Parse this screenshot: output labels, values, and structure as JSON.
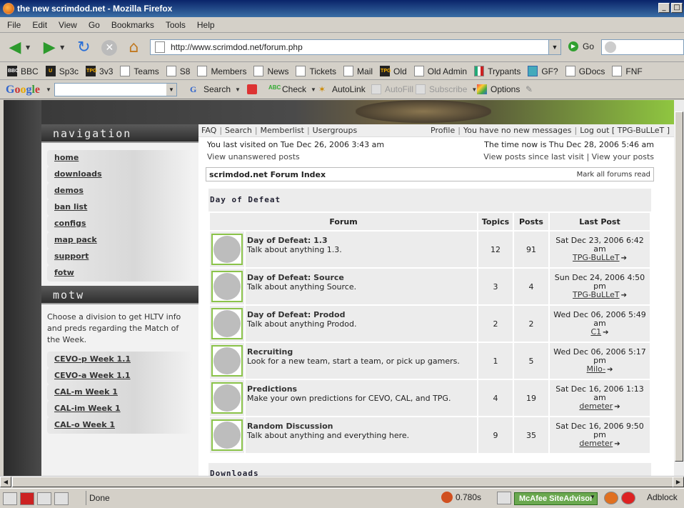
{
  "window": {
    "title": "the new scrimdod.net - Mozilla Firefox"
  },
  "menu": [
    "File",
    "Edit",
    "View",
    "Go",
    "Bookmarks",
    "Tools",
    "Help"
  ],
  "nav": {
    "url": "http://www.scrimdod.net/forum.php",
    "go_label": "Go"
  },
  "bookmarks": [
    {
      "label": "BBC",
      "icon": "bbc"
    },
    {
      "label": "Sp3c",
      "icon": "sp3c"
    },
    {
      "label": "3v3",
      "icon": "tpg"
    },
    {
      "label": "Teams",
      "icon": "page"
    },
    {
      "label": "S8",
      "icon": "page"
    },
    {
      "label": "Members",
      "icon": "page"
    },
    {
      "label": "News",
      "icon": "page"
    },
    {
      "label": "Tickets",
      "icon": "page"
    },
    {
      "label": "Mail",
      "icon": "page"
    },
    {
      "label": "Old",
      "icon": "tpg"
    },
    {
      "label": "Old Admin",
      "icon": "page"
    },
    {
      "label": "Trypants",
      "icon": "flag"
    },
    {
      "label": "GF?",
      "icon": "blue"
    },
    {
      "label": "GDocs",
      "icon": "page"
    },
    {
      "label": "FNF",
      "icon": "page"
    }
  ],
  "googlebar": {
    "logo": "Google",
    "search_label": "Search",
    "check_label": "Check",
    "autolink_label": "AutoLink",
    "autofill_label": "AutoFill",
    "subscribe_label": "Subscribe",
    "options_label": "Options"
  },
  "sidebar": {
    "nav_heading": "navigation",
    "nav_items": [
      "home",
      "downloads",
      "demos",
      "ban list",
      "configs",
      "map pack",
      "support",
      "fotw"
    ],
    "motw_heading": "motw",
    "motw_text": "Choose a division to get HLTV info and preds regarding the Match of the Week.",
    "motw_items": [
      "CEVO-p Week 1.1",
      "CEVO-a Week 1.1",
      "CAL-m Week 1",
      "CAL-im Week 1",
      "CAL-o Week 1"
    ]
  },
  "topnav": {
    "left": [
      "FAQ",
      "Search",
      "Memberlist",
      "Usergroups"
    ],
    "profile": "Profile",
    "messages": "You have no new messages",
    "logout": "Log out [ TPG-BuLLeT ]"
  },
  "info": {
    "last_visit": "You last visited on Tue Dec 26, 2006 3:43 am",
    "time_now": "The time now is Thu Dec 28, 2006 5:46 am",
    "unanswered": "View unanswered posts",
    "since_last": "View posts since last visit",
    "your_posts": "View your posts"
  },
  "crumb": {
    "index": "scrimdod.net Forum Index",
    "mark_read": "Mark all forums read"
  },
  "category": {
    "title": "Day of Defeat",
    "headers": {
      "forum": "Forum",
      "topics": "Topics",
      "posts": "Posts",
      "last_post": "Last Post"
    },
    "forums": [
      {
        "name": "Day of Defeat: 1.3",
        "desc": "Talk about anything 1.3.",
        "topics": "12",
        "posts": "91",
        "last_date": "Sat Dec 23, 2006 6:42 am",
        "last_user": "TPG-BuLLeT"
      },
      {
        "name": "Day of Defeat: Source",
        "desc": "Talk about anything Source.",
        "topics": "3",
        "posts": "4",
        "last_date": "Sun Dec 24, 2006 4:50 pm",
        "last_user": "TPG-BuLLeT"
      },
      {
        "name": "Day of Defeat: Prodod",
        "desc": "Talk about anything Prodod.",
        "topics": "2",
        "posts": "2",
        "last_date": "Wed Dec 06, 2006 5:49 am",
        "last_user": "C1"
      },
      {
        "name": "Recruiting",
        "desc": "Look for a new team, start a team, or pick up gamers.",
        "topics": "1",
        "posts": "5",
        "last_date": "Wed Dec 06, 2006 5:17 pm",
        "last_user": "Milo-"
      },
      {
        "name": "Predictions",
        "desc": "Make your own predictions for CEVO, CAL, and TPG.",
        "topics": "4",
        "posts": "19",
        "last_date": "Sat Dec 16, 2006 1:13 am",
        "last_user": "demeter"
      },
      {
        "name": "Random Discussion",
        "desc": "Talk about anything and everything here.",
        "topics": "9",
        "posts": "35",
        "last_date": "Sat Dec 16, 2006 9:50 pm",
        "last_user": "demeter"
      }
    ]
  },
  "next_category": "Downloads",
  "status": {
    "text": "Done",
    "time": "0.780s",
    "mcafee": "McAfee SiteAdvisor",
    "adblock": "Adblock"
  }
}
